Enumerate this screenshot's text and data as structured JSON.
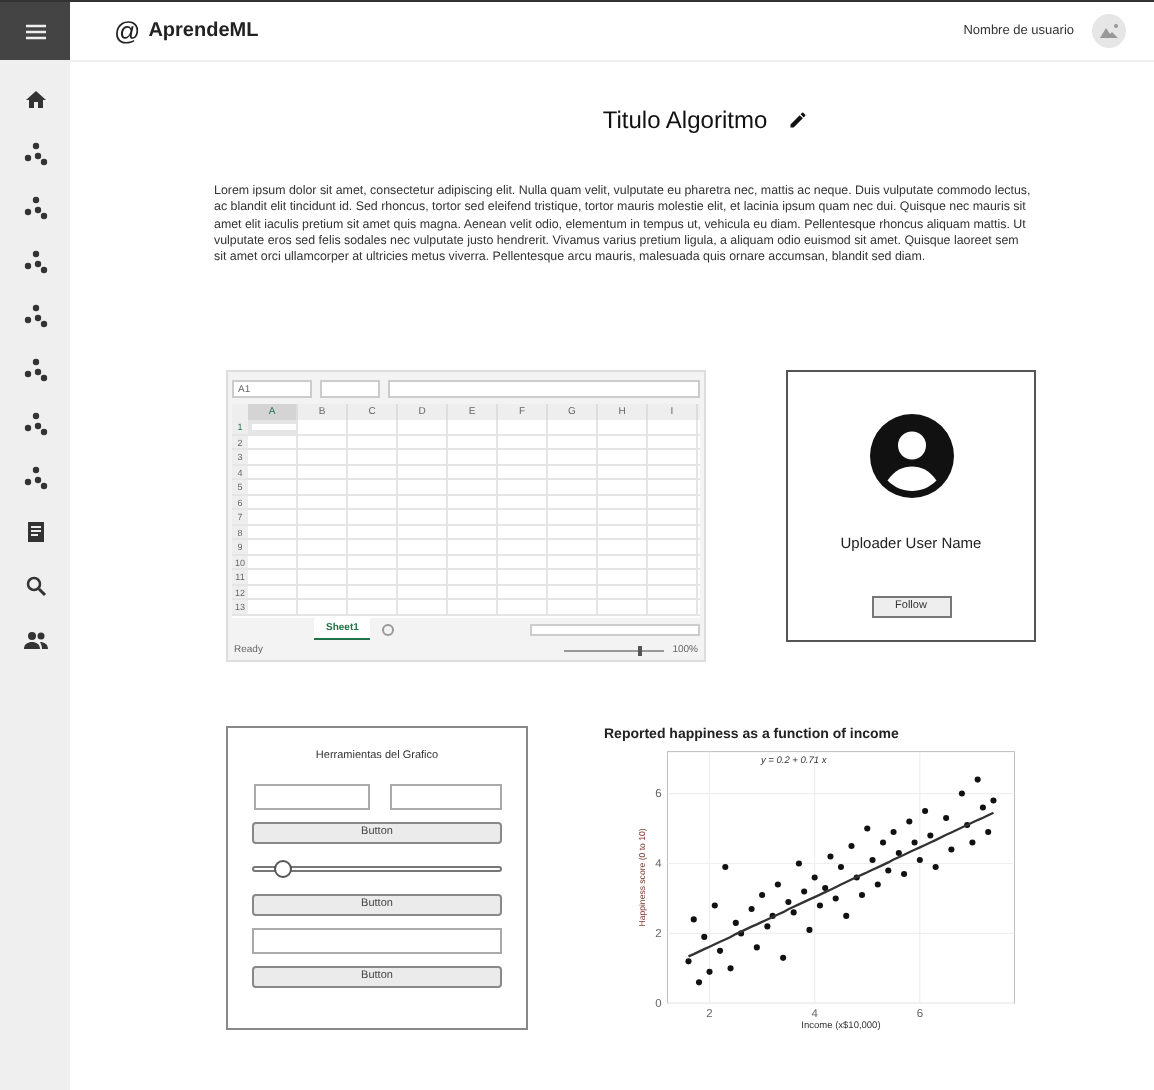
{
  "header": {
    "logo_mark": "@",
    "brand": "AprendeML",
    "user_name": "Nombre de usuario"
  },
  "page": {
    "title": "Titulo Algoritmo",
    "description": "Lorem ipsum dolor sit amet, consectetur adipiscing elit. Nulla quam velit, vulputate eu pharetra nec, mattis ac neque. Duis vulputate commodo lectus, ac blandit elit tincidunt id. Sed rhoncus, tortor sed eleifend tristique, tortor mauris molestie elit, et lacinia ipsum quam nec dui. Quisque nec mauris sit amet elit iaculis pretium sit amet quis magna. Aenean velit odio, elementum in tempus ut, vehicula eu diam. Pellentesque rhoncus aliquam mattis. Ut vulputate eros sed felis sodales nec vulputate justo hendrerit. Vivamus varius pretium ligula, a aliquam odio euismod sit amet. Quisque laoreet sem sit amet orci ullamcorper at ultricies metus viverra. Pellentesque arcu mauris, malesuada quis ornare accumsan, blandit sed diam."
  },
  "spreadsheet": {
    "name_box": "A1",
    "columns": [
      "A",
      "B",
      "C",
      "D",
      "E",
      "F",
      "G",
      "H",
      "I"
    ],
    "rows": [
      "1",
      "2",
      "3",
      "4",
      "5",
      "6",
      "7",
      "8",
      "9",
      "10",
      "11",
      "12",
      "13"
    ],
    "sheet_tabs": [
      {
        "label": "Sheet1",
        "selected": true
      }
    ],
    "status": "Ready",
    "zoom_slider": {
      "level": 0.75
    },
    "zoom": "100%"
  },
  "uploader": {
    "name": "Uploader User Name",
    "follow_button": "Follow"
  },
  "tools": {
    "title": "Herramientas del Grafico",
    "controls": [
      {
        "kind": "field_pair"
      },
      {
        "kind": "button",
        "label": "Button"
      },
      {
        "kind": "slider",
        "level": 0.12
      },
      {
        "kind": "button",
        "label": "Button"
      },
      {
        "kind": "field"
      },
      {
        "kind": "button",
        "label": "Button"
      }
    ]
  },
  "chart": {
    "chart_data": {
      "type": "scatter",
      "title": "Reported happiness as a function of income",
      "xlabel": "Income (x$10,000)",
      "ylabel": "Happiness score (0 to 10)",
      "x": [
        1.6,
        1.7,
        1.8,
        1.9,
        2.0,
        2.1,
        2.2,
        2.3,
        2.4,
        2.5,
        2.6,
        2.8,
        2.9,
        3.0,
        3.1,
        3.2,
        3.3,
        3.4,
        3.5,
        3.6,
        3.7,
        3.8,
        3.9,
        4.0,
        4.1,
        4.2,
        4.3,
        4.4,
        4.5,
        4.6,
        4.7,
        4.8,
        4.9,
        5.0,
        5.1,
        5.2,
        5.3,
        5.4,
        5.5,
        5.6,
        5.7,
        5.8,
        5.9,
        6.0,
        6.1,
        6.2,
        6.3,
        6.5,
        6.6,
        6.8,
        6.9,
        7.0,
        7.1,
        7.2,
        7.3,
        7.4
      ],
      "series": [
        {
          "color": "#111111",
          "values": [
            1.2,
            2.4,
            0.6,
            1.9,
            0.9,
            2.8,
            1.5,
            3.9,
            1.0,
            2.3,
            2.0,
            2.7,
            1.6,
            3.1,
            2.2,
            2.5,
            3.4,
            1.3,
            2.9,
            2.6,
            4.0,
            3.2,
            2.1,
            3.6,
            2.8,
            3.3,
            4.2,
            3.0,
            3.9,
            2.5,
            4.5,
            3.6,
            3.1,
            5.0,
            4.1,
            3.4,
            4.6,
            3.8,
            4.9,
            4.3,
            3.7,
            5.2,
            4.6,
            4.1,
            5.5,
            4.8,
            3.9,
            5.3,
            4.4,
            6.0,
            5.1,
            4.6,
            6.4,
            5.6,
            4.9,
            5.8
          ]
        },
        {
          "type": "line",
          "color": "#333333",
          "values": [
            1.34,
            1.41,
            1.48,
            1.55,
            1.62,
            1.69,
            1.76,
            1.83,
            1.9,
            1.98,
            2.05,
            2.19,
            2.26,
            2.33,
            2.4,
            2.47,
            2.54,
            2.61,
            2.69,
            2.76,
            2.83,
            2.9,
            2.97,
            3.04,
            3.11,
            3.18,
            3.25,
            3.32,
            3.4,
            3.47,
            3.54,
            3.61,
            3.68,
            3.75,
            3.82,
            3.89,
            3.96,
            4.03,
            4.11,
            4.18,
            4.25,
            4.32,
            4.39,
            4.46,
            4.53,
            4.6,
            4.67,
            4.82,
            4.89,
            5.03,
            5.1,
            5.17,
            5.24,
            5.31,
            5.38,
            5.45
          ]
        }
      ],
      "grid": true,
      "xlim": [
        1.2,
        7.8
      ],
      "ylim": [
        0,
        7.2
      ],
      "xticks": [
        2,
        4,
        6
      ],
      "yticks": [
        0,
        2,
        4,
        6
      ],
      "annotations": [
        "y = 0.2 + 0.71 x"
      ]
    }
  }
}
